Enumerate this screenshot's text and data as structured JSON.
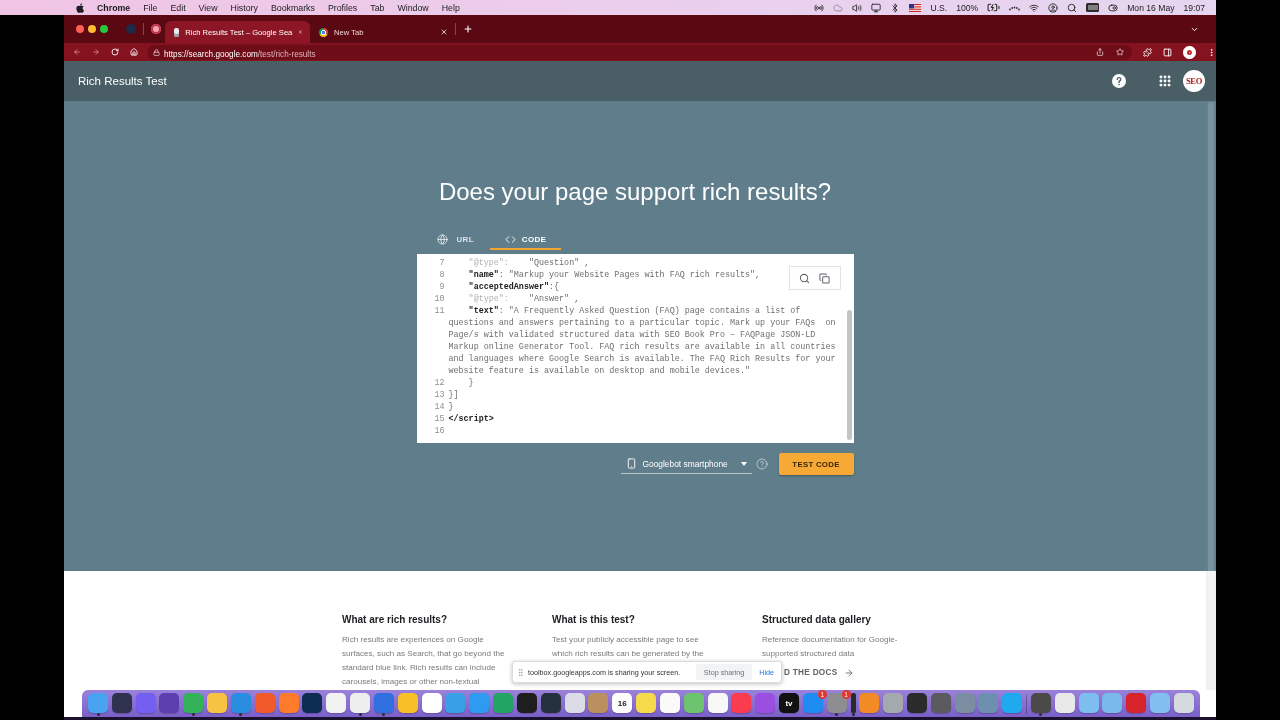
{
  "menu_bar": {
    "app": "Chrome",
    "menus": [
      "File",
      "Edit",
      "View",
      "History",
      "Bookmarks",
      "Profiles",
      "Tab",
      "Window",
      "Help"
    ],
    "keyboard_layout": "U.S.",
    "battery": "100%",
    "date": "Mon 16 May",
    "time": "19:07"
  },
  "browser": {
    "tabs": [
      {
        "kind": "page",
        "title": "Rich Results Test – Google Sea",
        "selected": true
      },
      {
        "kind": "new_tab",
        "title": "New Tab",
        "selected": false
      }
    ],
    "url": {
      "origin": "https://search.google.com",
      "path": "/test/rich-results"
    }
  },
  "page": {
    "header": {
      "title": "Rich Results Test",
      "avatar_text": "SEO"
    },
    "hero": {
      "title": "Does your page support rich results?",
      "input_tabs": [
        {
          "kind": "url",
          "label": "URL",
          "selected": false
        },
        {
          "kind": "code",
          "label": "CODE",
          "selected": true
        }
      ],
      "code_lines": [
        {
          "number": "7",
          "parts": [
            {
              "kind": "faded",
              "text": "    \"@type\":"
            },
            {
              "kind": "value",
              "text": "    \"Question\" ,"
            }
          ]
        },
        {
          "number": "8",
          "parts": [
            {
              "kind": "key",
              "text": "    \"name\""
            },
            {
              "kind": "value",
              "text": ": \"Markup your Website Pages with FAQ rich results\","
            }
          ]
        },
        {
          "number": "9",
          "parts": [
            {
              "kind": "key",
              "text": "    \"acceptedAnswer\""
            },
            {
              "kind": "value",
              "text": ":{"
            }
          ]
        },
        {
          "number": "10",
          "parts": [
            {
              "kind": "faded",
              "text": "    \"@type\":"
            },
            {
              "kind": "value",
              "text": "    \"Answer\" ,"
            }
          ]
        },
        {
          "number": "11",
          "parts": [
            {
              "kind": "key",
              "text": "    \"text\""
            },
            {
              "kind": "value",
              "text": ": \"A Frequently Asked Question (FAQ) page contains a list of questions and answers pertaining to a particular topic. Mark up your FAQs  on Page/s with validated structured data with SEO Book Pro – FAQPage JSON-LD Markup online Generator Tool. FAQ rich results are available in all countries and languages where Google Search is available. The FAQ Rich Results for your website feature is available on desktop and mobile devices.\""
            }
          ]
        },
        {
          "number": "12",
          "parts": [
            {
              "kind": "value",
              "text": "    }"
            }
          ]
        },
        {
          "number": "13",
          "parts": [
            {
              "kind": "value",
              "text": "}]"
            }
          ]
        },
        {
          "number": "14",
          "parts": [
            {
              "kind": "value",
              "text": "}"
            }
          ]
        },
        {
          "number": "15",
          "parts": [
            {
              "kind": "key",
              "text": "</script>"
            }
          ]
        },
        {
          "number": "16"
        }
      ],
      "device": "Googlebot smartphone",
      "test_button": "TEST CODE"
    },
    "info_columns": [
      {
        "title": "What are rich results?",
        "lines": [
          "Rich results are experiences on Google",
          "surfaces, such as Search, that go beyond the",
          "standard blue link. Rich results can include",
          "carousels, images or other non-textual"
        ]
      },
      {
        "title": "What is this test?",
        "lines": [
          "Test your publicly accessible page to see",
          "which rich results can be generated by the"
        ]
      },
      {
        "title": "Structured data gallery",
        "lines": [
          "Reference documentation for Google-",
          "supported structured data"
        ],
        "link": "D THE DOCS"
      }
    ],
    "share_notice": {
      "message": "toolbox.googleapps.com is sharing your screen.",
      "stop_button": "Stop sharing",
      "hide_link": "Hide"
    }
  },
  "dock": {
    "items": [
      {
        "kind": "app",
        "color": "#4aa3f0",
        "running": true
      },
      {
        "kind": "app",
        "color": "#2f3350",
        "running": false
      },
      {
        "kind": "app",
        "color": "#7360f2",
        "running": false
      },
      {
        "kind": "app",
        "color": "#5d3fb0",
        "running": false
      },
      {
        "kind": "app",
        "color": "#32b35a",
        "running": true
      },
      {
        "kind": "app",
        "color": "#f6c342",
        "running": false
      },
      {
        "kind": "app",
        "color": "#2a8ee0",
        "running": true
      },
      {
        "kind": "app",
        "color": "#f25a2c",
        "running": false
      },
      {
        "kind": "app",
        "color": "#ff7a2a",
        "running": false
      },
      {
        "kind": "app",
        "color": "#0d2d52",
        "running": false
      },
      {
        "kind": "app",
        "color": "#f2f2f2",
        "running": false
      },
      {
        "kind": "app",
        "color": "#eeeeee",
        "running": true
      },
      {
        "kind": "app",
        "color": "#2f6fe0",
        "running": true
      },
      {
        "kind": "app",
        "color": "#f6c026",
        "running": false
      },
      {
        "kind": "app",
        "color": "#ffffff",
        "running": false
      },
      {
        "kind": "app",
        "color": "#3aa0e6",
        "running": false
      },
      {
        "kind": "app",
        "color": "#2d9bf0",
        "running": false
      },
      {
        "kind": "app",
        "color": "#21a464",
        "running": false
      },
      {
        "kind": "app",
        "color": "#1e1e1e",
        "running": false
      },
      {
        "kind": "app",
        "color": "#25313e",
        "running": false
      },
      {
        "kind": "app",
        "color": "#dcdce6",
        "running": false
      },
      {
        "kind": "app",
        "color": "#b9905e",
        "running": false
      },
      {
        "kind": "app",
        "color": "#fdfdfd",
        "running": false,
        "label": "16"
      },
      {
        "kind": "app",
        "color": "#f7d94c",
        "running": false
      },
      {
        "kind": "app",
        "color": "#fafafa",
        "running": false
      },
      {
        "kind": "app",
        "color": "#6cc46f",
        "running": false
      },
      {
        "kind": "app",
        "color": "#f8f8f8",
        "running": false
      },
      {
        "kind": "app",
        "color": "#fb3c4e",
        "running": false
      },
      {
        "kind": "app",
        "color": "#9a4fe0",
        "running": false
      },
      {
        "kind": "app",
        "color": "#111111",
        "running": false,
        "label": "tv"
      },
      {
        "kind": "app",
        "color": "#1f8cf2",
        "running": false,
        "badge": "1"
      },
      {
        "kind": "app",
        "color": "#8d8d92",
        "running": true,
        "badge": "1"
      },
      {
        "kind": "narrow",
        "color": "#2a2a2a",
        "running": true
      },
      {
        "kind": "app",
        "color": "#f28a25",
        "running": false
      },
      {
        "kind": "app",
        "color": "#a4a9ae",
        "running": false
      },
      {
        "kind": "app",
        "color": "#2b2b2b",
        "running": false
      },
      {
        "kind": "app",
        "color": "#5b5b5f",
        "running": false
      },
      {
        "kind": "app",
        "color": "#7b8da0",
        "running": false
      },
      {
        "kind": "app",
        "color": "#6f8fb0",
        "running": false
      },
      {
        "kind": "app",
        "color": "#1fa9ee",
        "running": false
      },
      {
        "kind": "separator"
      },
      {
        "kind": "app",
        "color": "#4a4a4a",
        "running": true
      },
      {
        "kind": "app",
        "color": "#e9e9e9",
        "running": false
      },
      {
        "kind": "app",
        "color": "#7dbdf0",
        "running": false
      },
      {
        "kind": "app",
        "color": "#7ab9ec",
        "running": false
      },
      {
        "kind": "app",
        "color": "#d7242b",
        "running": false
      },
      {
        "kind": "app",
        "color": "#80bff0",
        "running": false
      },
      {
        "kind": "app",
        "color": "#d6dade",
        "running": false
      }
    ]
  }
}
